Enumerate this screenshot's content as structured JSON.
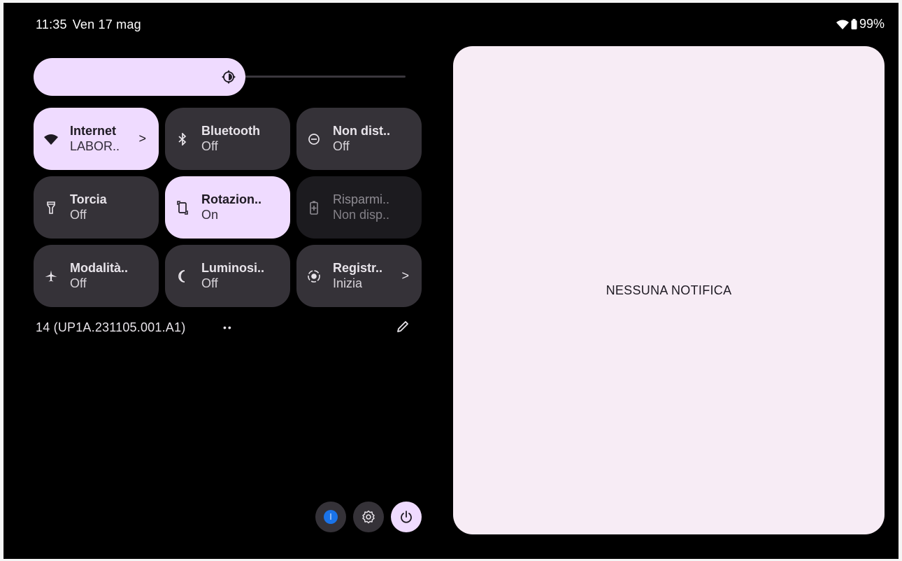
{
  "status_bar": {
    "time": "11:35",
    "date": "Ven 17 mag",
    "battery": "99%",
    "icons": [
      "wifi-icon",
      "battery-icon"
    ]
  },
  "brightness": {
    "level": 0.57,
    "icon": "brightness-icon"
  },
  "tiles": [
    {
      "title": "Internet",
      "subtitle": "LABOR..",
      "state": "active",
      "icon": "wifi-icon",
      "chevron": ">"
    },
    {
      "title": "Bluetooth",
      "subtitle": "Off",
      "state": "inactive",
      "icon": "bluetooth-icon"
    },
    {
      "title": "Non dist..",
      "subtitle": "Off",
      "state": "inactive",
      "icon": "do-not-disturb-icon"
    },
    {
      "title": "Torcia",
      "subtitle": "Off",
      "state": "inactive",
      "icon": "flashlight-icon"
    },
    {
      "title": "Rotazion..",
      "subtitle": "On",
      "state": "active",
      "icon": "rotation-icon"
    },
    {
      "title": "Risparmi..",
      "subtitle": "Non disp..",
      "state": "disabled",
      "icon": "battery-saver-icon"
    },
    {
      "title": "Modalità..",
      "subtitle": "Off",
      "state": "inactive",
      "icon": "airplane-icon"
    },
    {
      "title": "Luminosi..",
      "subtitle": "Off",
      "state": "inactive",
      "icon": "night-light-icon"
    },
    {
      "title": "Registr..",
      "subtitle": "Inizia",
      "state": "inactive",
      "icon": "screen-record-icon",
      "chevron": ">"
    }
  ],
  "footer": {
    "build": "14 (UP1A.231105.001.A1)",
    "page_dots": "••"
  },
  "notifications": {
    "empty_text": "NESSUNA NOTIFICA"
  },
  "colors": {
    "accent": "#efdbff",
    "tile_inactive": "#353238",
    "panel_bg": "#f7ecf5",
    "user_badge": "#1a73e8"
  }
}
